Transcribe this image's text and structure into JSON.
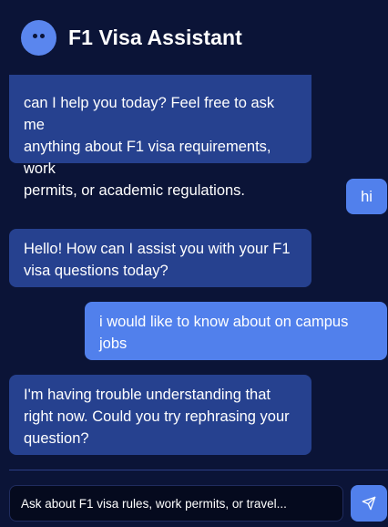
{
  "header": {
    "title": "F1 Visa Assistant"
  },
  "messages": [
    {
      "role": "bot",
      "lines": [
        "can I help you today? Feel free to ask me",
        "anything about F1 visa requirements, work",
        "permits, or academic regulations."
      ]
    },
    {
      "role": "user",
      "lines": [
        "hi"
      ]
    },
    {
      "role": "bot",
      "lines": [
        "Hello! How can I assist you with your F1",
        "visa questions today?"
      ]
    },
    {
      "role": "user",
      "lines": [
        "i would like to know about on campus",
        "jobs"
      ]
    },
    {
      "role": "bot",
      "lines": [
        "I'm having trouble understanding that",
        "right now. Could you try rephrasing your",
        "question?"
      ]
    }
  ],
  "composer": {
    "placeholder": "Ask about F1 visa rules, work permits, or travel...",
    "send_icon": "send-icon"
  },
  "colors": {
    "background": "#0b1437",
    "bot_bubble": "#26418f",
    "user_bubble": "#5180ec",
    "accent": "#5a86ee"
  }
}
